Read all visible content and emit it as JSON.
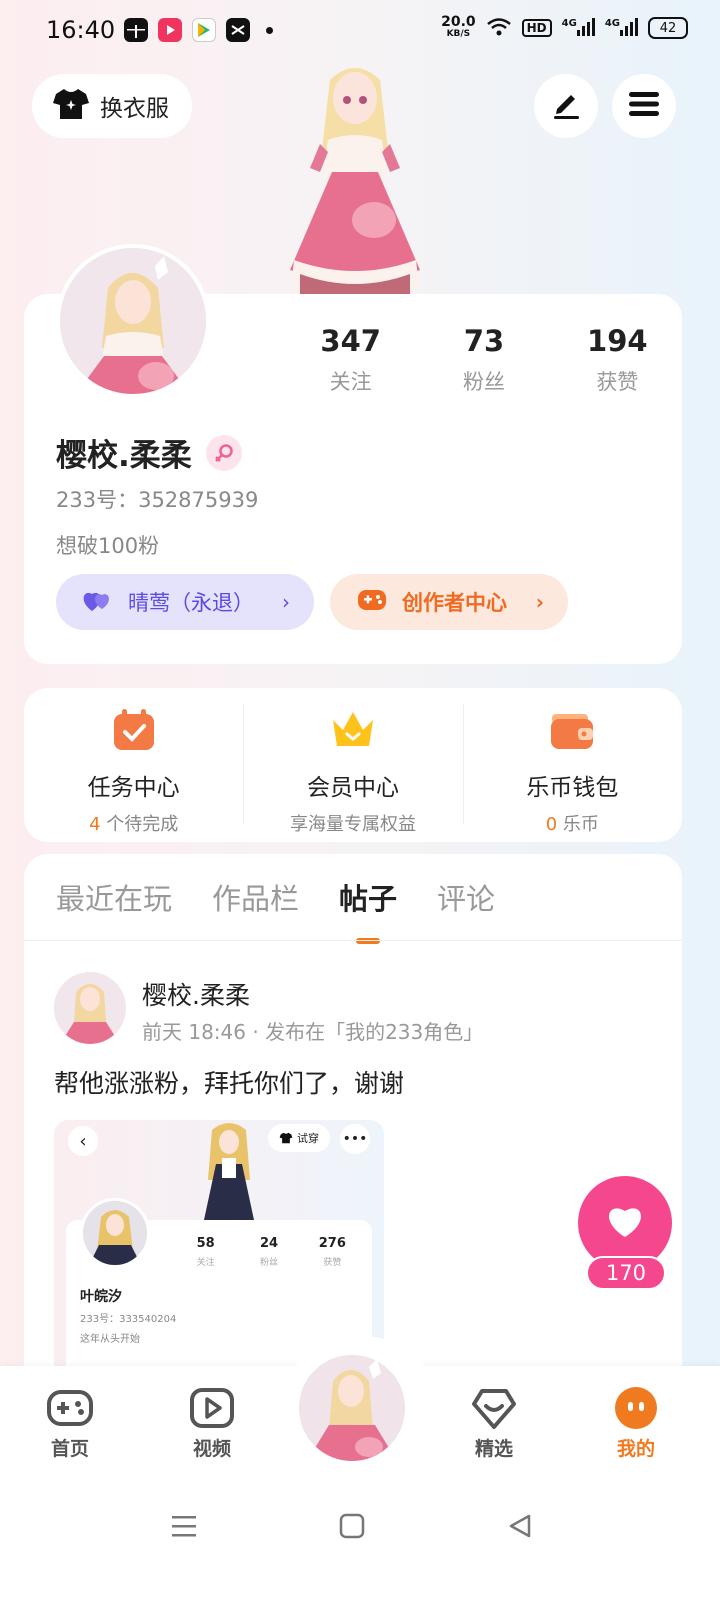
{
  "status_bar": {
    "time": "16:40",
    "speed_value": "20.0",
    "speed_unit": "KB/S",
    "hd": "HD",
    "signal1": "4G",
    "signal2": "4G",
    "battery": "42"
  },
  "top": {
    "outfit_label": "换衣服"
  },
  "profile": {
    "stats": [
      {
        "value": "347",
        "label": "关注"
      },
      {
        "value": "73",
        "label": "粉丝"
      },
      {
        "value": "194",
        "label": "获赞"
      }
    ],
    "name": "樱校.柔柔",
    "uid": "233号：352875939",
    "bio": "想破100粉",
    "tag_label": "晴莺（永退）",
    "creator_label": "创作者中心"
  },
  "services": [
    {
      "title": "任务中心",
      "sub_highlight": "4",
      "sub_text": " 个待完成",
      "icon": "calendar-check-icon"
    },
    {
      "title": "会员中心",
      "sub_highlight": "",
      "sub_text": "享海量专属权益",
      "icon": "crown-icon"
    },
    {
      "title": "乐币钱包",
      "sub_highlight": "0",
      "sub_text": " 乐币",
      "icon": "wallet-icon"
    }
  ],
  "tabs": [
    "最近在玩",
    "作品栏",
    "帖子",
    "评论"
  ],
  "post": {
    "author": "樱校.柔柔",
    "meta": "前天 18:46 · 发布在「我的233角色」",
    "text": "帮他涨涨粉，拜托你们了，谢谢",
    "image": {
      "try_label": "试穿",
      "stats": [
        {
          "value": "58",
          "label": "关注"
        },
        {
          "value": "24",
          "label": "粉丝"
        },
        {
          "value": "276",
          "label": "获赞"
        }
      ],
      "name": "叶皖汐",
      "uid": "233号：333540204",
      "bio": "这年从头开始"
    }
  },
  "like_count": "170",
  "nav": [
    {
      "label": "首页",
      "icon": "gamepad-icon"
    },
    {
      "label": "视频",
      "icon": "video-icon"
    },
    {
      "label": "精选",
      "icon": "heart-shield-icon"
    },
    {
      "label": "我的",
      "icon": "profile-face-icon"
    }
  ],
  "colors": {
    "accent_orange": "#f07a20",
    "like_pink": "#f4478e",
    "tag_purple": "#5a4be3"
  }
}
